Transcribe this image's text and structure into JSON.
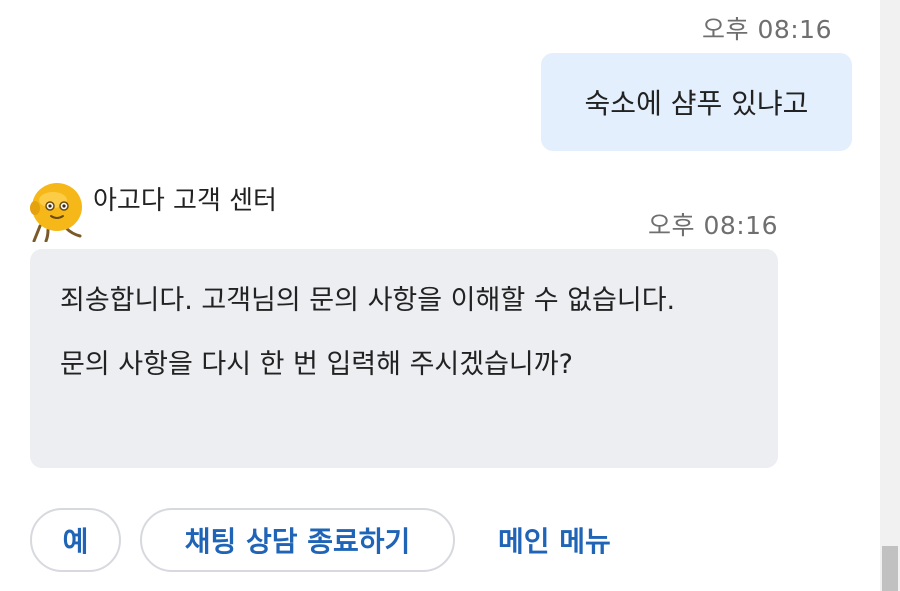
{
  "user_message": {
    "time": "오후 08:16",
    "text": "숙소에 샴푸 있냐고"
  },
  "bot_message": {
    "sender_name": "아고다 고객 센터",
    "avatar_icon": "mascot-avatar-icon",
    "time": "오후 08:16",
    "paragraphs": [
      "죄송합니다. 고객님의 문의 사항을 이해할 수 없습니다.",
      "문의 사항을 다시 한 번 입력해 주시겠습니까?"
    ]
  },
  "quick_replies": {
    "yes": "예",
    "end_chat": "채팅 상담 종료하기",
    "main_menu": "메인 메뉴"
  },
  "colors": {
    "user_bubble": "#e3effc",
    "bot_bubble": "#eceef2",
    "accent": "#1f64b6",
    "avatar_yellow": "#f6b818"
  }
}
